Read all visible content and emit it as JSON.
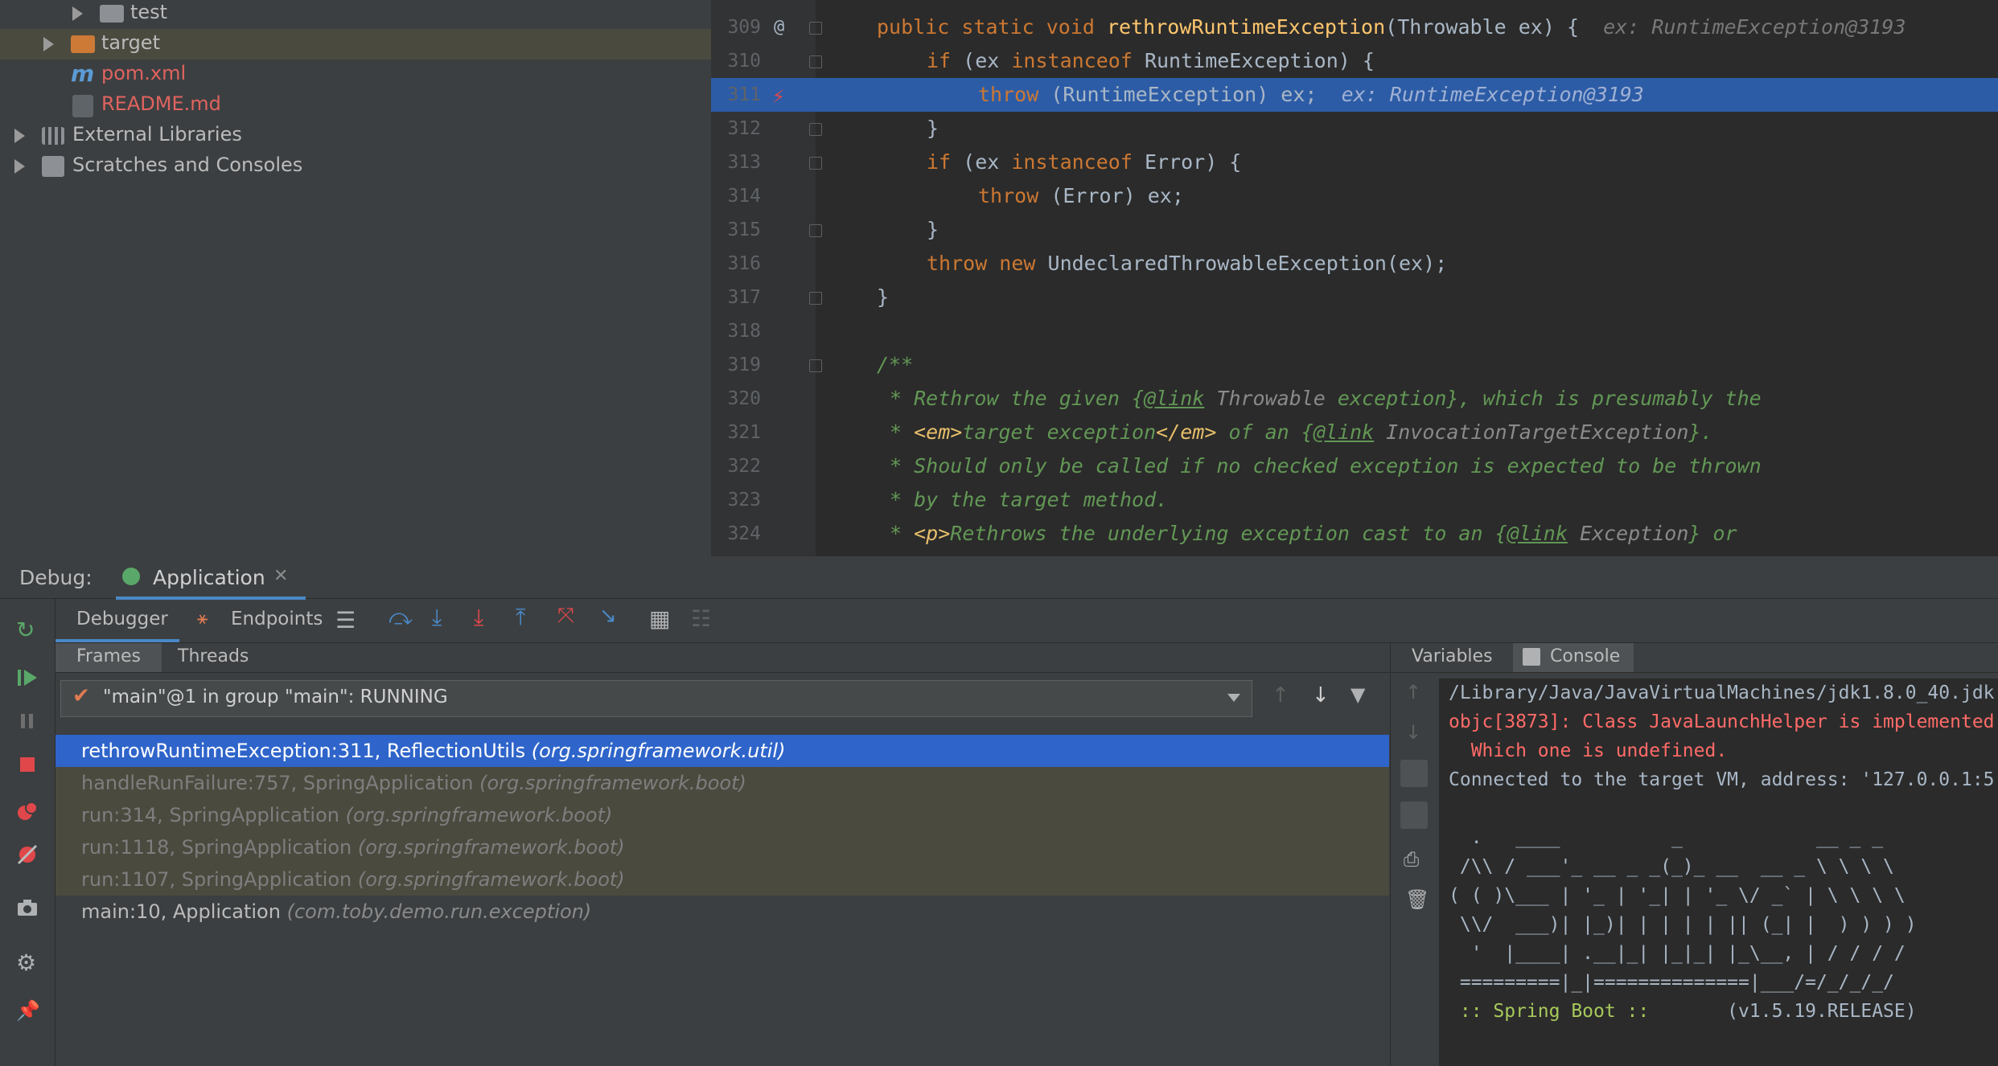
{
  "project_tree": {
    "items": [
      {
        "label": "test",
        "type": "folder"
      },
      {
        "label": "target",
        "type": "folder-excluded"
      },
      {
        "label": "pom.xml",
        "type": "maven-file"
      },
      {
        "label": "README.md",
        "type": "markdown-file"
      },
      {
        "label": "External Libraries",
        "type": "libraries"
      },
      {
        "label": "Scratches and Consoles",
        "type": "scratches"
      }
    ]
  },
  "editor": {
    "lines": [
      {
        "num": "309"
      },
      {
        "num": "310"
      },
      {
        "num": "311"
      },
      {
        "num": "312"
      },
      {
        "num": "313"
      },
      {
        "num": "314"
      },
      {
        "num": "315"
      },
      {
        "num": "316"
      },
      {
        "num": "317"
      },
      {
        "num": "318"
      },
      {
        "num": "319"
      },
      {
        "num": "320"
      },
      {
        "num": "321"
      },
      {
        "num": "322"
      },
      {
        "num": "323"
      },
      {
        "num": "324"
      }
    ],
    "code": {
      "l309": {
        "a": "public static void ",
        "fn": "rethrowRuntimeException",
        "b": "(Throwable ex) {",
        "hint": "ex: RuntimeException@3193"
      },
      "l310": {
        "a": "if",
        "b": " (ex ",
        "c": "instanceof",
        "d": " RuntimeException) {"
      },
      "l311": {
        "a": "throw",
        "b": " (RuntimeException) ex;",
        "hint": "ex: RuntimeException@3193"
      },
      "l312": {
        "a": "}"
      },
      "l313": {
        "a": "if",
        "b": " (ex ",
        "c": "instanceof",
        "d": " Error) {"
      },
      "l314": {
        "a": "throw",
        "b": " (Error) ex;"
      },
      "l315": {
        "a": "}"
      },
      "l316": {
        "a": "throw new",
        "b": " UndeclaredThrowableException(ex);"
      },
      "l317": {
        "a": "}"
      },
      "l319": {
        "a": "/**"
      },
      "l320": {
        "a": "* Rethrow the given {",
        "lnk": "@link",
        "ref": " Throwable",
        "b": " exception}, which is presumably the"
      },
      "l321": {
        "a": "* ",
        "t1": "<em>",
        "b": "target exception",
        "t2": "</em>",
        "c": " of an {",
        "lnk": "@link",
        "ref": " InvocationTargetException",
        "d": "}."
      },
      "l322": {
        "a": "* Should only be called if no checked exception is expected to be thrown"
      },
      "l323": {
        "a": "* by the target method."
      },
      "l324": {
        "a": "* ",
        "t1": "<p>",
        "b": "Rethrows the underlying exception cast to an {",
        "lnk": "@link",
        "ref": " Exception",
        "c": "} or"
      }
    },
    "gutter_marker_309": "@"
  },
  "debug": {
    "title": "Debug:",
    "session_tab": "Application",
    "tabs": {
      "debugger": "Debugger",
      "endpoints": "Endpoints"
    },
    "sub_tabs": {
      "frames": "Frames",
      "threads": "Threads"
    },
    "thread_select": "\"main\"@1 in group \"main\": RUNNING",
    "frames": [
      {
        "method": "rethrowRuntimeException:311, ReflectionUtils",
        "pkg": "(org.springframework.util)",
        "state": "selected"
      },
      {
        "method": "handleRunFailure:757, SpringApplication",
        "pkg": "(org.springframework.boot)",
        "state": "library"
      },
      {
        "method": "run:314, SpringApplication",
        "pkg": "(org.springframework.boot)",
        "state": "library"
      },
      {
        "method": "run:1118, SpringApplication",
        "pkg": "(org.springframework.boot)",
        "state": "library"
      },
      {
        "method": "run:1107, SpringApplication",
        "pkg": "(org.springframework.boot)",
        "state": "library"
      },
      {
        "method": "main:10, Application",
        "pkg": "(com.toby.demo.run.exception)",
        "state": "normal"
      }
    ],
    "right_tabs": {
      "variables": "Variables",
      "console": "Console"
    },
    "console_lines": [
      {
        "text": "/Library/Java/JavaVirtualMachines/jdk1.8.0_40.jdk",
        "color": "#a9b7c6"
      },
      {
        "text": "objc[3873]: Class JavaLaunchHelper is implemented",
        "color": "#ff6b68"
      },
      {
        "text": "  Which one is undefined.",
        "color": "#ff6b68"
      },
      {
        "text": "Connected to the target VM, address: '127.0.0.1:5",
        "color": "#a9b7c6"
      },
      {
        "text": "",
        "color": "#a9b7c6"
      },
      {
        "text": "  .   ____          _            __ _ _",
        "color": "#a9b7c6"
      },
      {
        "text": " /\\\\ / ___'_ __ _ _(_)_ __  __ _ \\ \\ \\ \\",
        "color": "#a9b7c6"
      },
      {
        "text": "( ( )\\___ | '_ | '_| | '_ \\/ _` | \\ \\ \\ \\",
        "color": "#a9b7c6"
      },
      {
        "text": " \\\\/  ___)| |_)| | | | | || (_| |  ) ) ) )",
        "color": "#a9b7c6"
      },
      {
        "text": "  '  |____| .__|_| |_|_| |_\\__, | / / / /",
        "color": "#a9b7c6"
      },
      {
        "text": " =========|_|==============|___/=/_/_/_/",
        "color": "#a9b7c6"
      },
      {
        "text": " :: Spring Boot ::       (v1.5.19.RELEASE)",
        "color": "#a9b7c6",
        "green_prefix": " :: Spring Boot ::"
      }
    ]
  }
}
